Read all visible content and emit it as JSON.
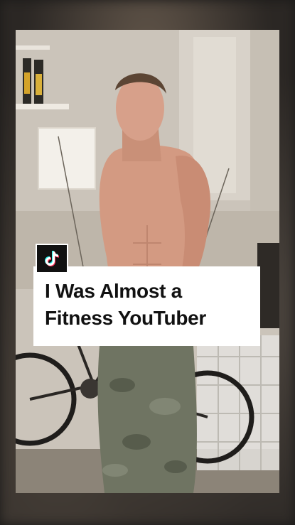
{
  "video": {
    "title_line1": "I Was Almost a",
    "title_line2": "Fitness YouTuber",
    "platform_icon": "tiktok-icon",
    "background_image": "shirtless-man-in-garage-photo"
  },
  "colors": {
    "card_bg": "#ffffff",
    "title_text": "#111111",
    "badge_bg": "#111111"
  }
}
